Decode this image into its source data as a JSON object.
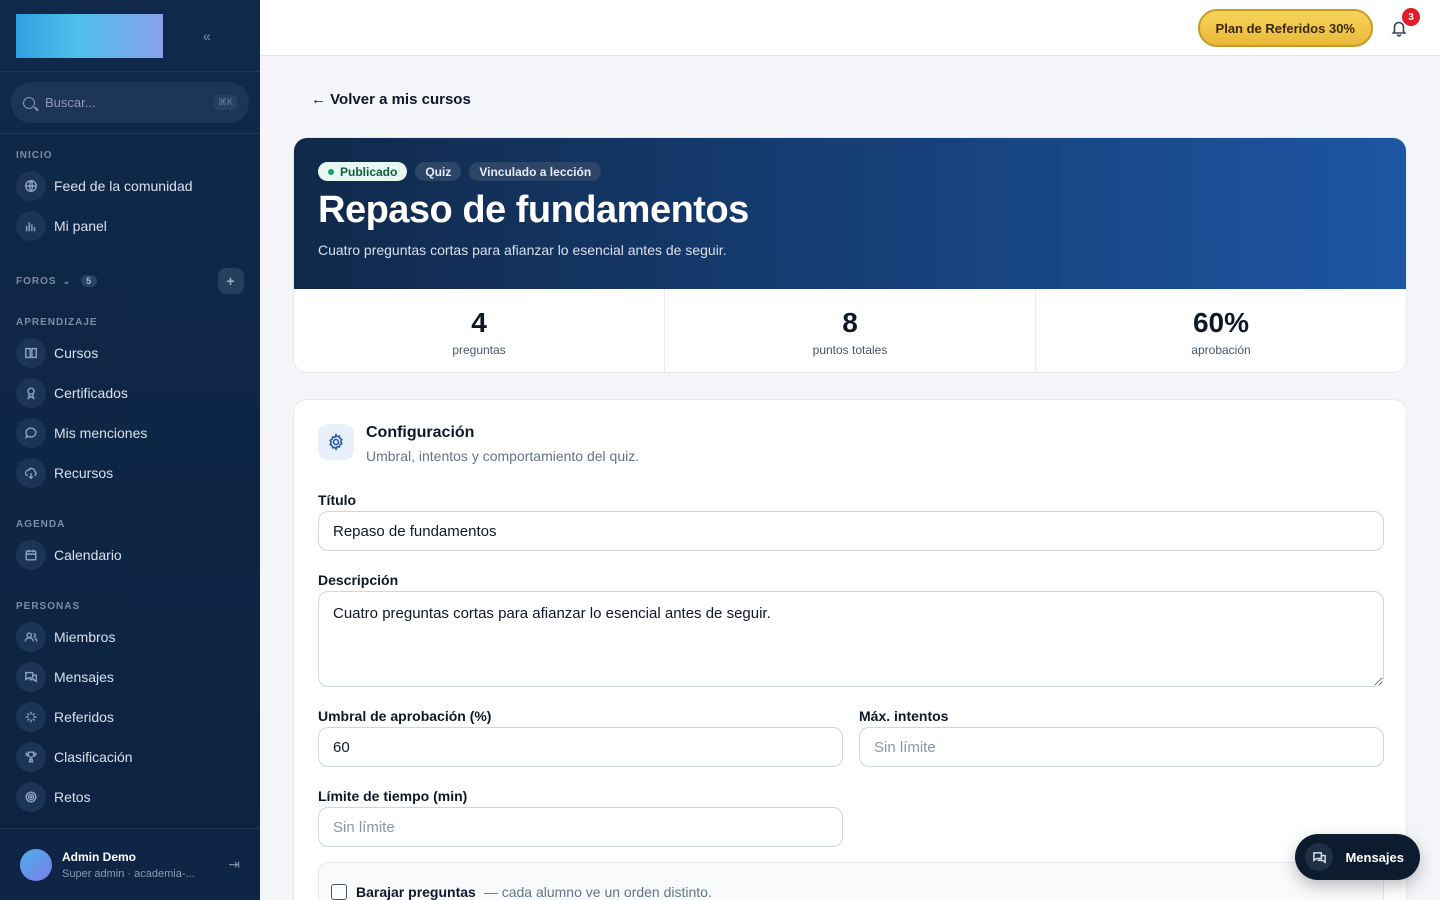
{
  "sidebar": {
    "collapse_glyph": "«",
    "search": {
      "placeholder": "Buscar...",
      "shortcut": "⌘K"
    },
    "sections": {
      "inicio": "INICIO",
      "foros": "FOROS",
      "foros_count": "5",
      "aprendizaje": "APRENDIZAJE",
      "agenda": "AGENDA",
      "personas": "PERSONAS"
    },
    "items": {
      "feed": "Feed de la comunidad",
      "panel": "Mi panel",
      "cursos": "Cursos",
      "certificados": "Certificados",
      "menciones": "Mis menciones",
      "recursos": "Recursos",
      "calendario": "Calendario",
      "miembros": "Miembros",
      "mensajes": "Mensajes",
      "referidos": "Referidos",
      "clasificacion": "Clasificación",
      "retos": "Retos"
    },
    "user": {
      "name": "Admin Demo",
      "role": "Super admin · academia-..."
    }
  },
  "topbar": {
    "referral_label": "Plan de Referidos 30%",
    "notifications_count": "3"
  },
  "main": {
    "back_label": "← Volver a mis cursos",
    "hero": {
      "tags": {
        "published": "Publicado",
        "type": "Quiz",
        "linked": "Vinculado a lección"
      },
      "title": "Repaso de fundamentos",
      "subtitle": "Cuatro preguntas cortas para afianzar lo esencial antes de seguir."
    },
    "stats": {
      "questions_value": "4",
      "questions_label": "preguntas",
      "points_value": "8",
      "points_label": "puntos totales",
      "pass_value": "60%",
      "pass_label": "aprobación"
    },
    "config": {
      "title": "Configuración",
      "subtitle": "Umbral, intentos y comportamiento del quiz.",
      "title_label": "Título",
      "title_value": "Repaso de fundamentos",
      "description_label": "Descripción",
      "description_value": "Cuatro preguntas cortas para afianzar lo esencial antes de seguir.",
      "threshold_label": "Umbral de aprobación (%)",
      "threshold_value": "60",
      "max_attempts_label": "Máx. intentos",
      "max_attempts_placeholder": "Sin límite",
      "time_limit_label": "Límite de tiempo (min)",
      "time_limit_placeholder": "Sin límite",
      "shuffle_label": "Barajar preguntas",
      "shuffle_hint": "— cada alumno ve un orden distinto."
    }
  },
  "floating": {
    "messages_label": "Mensajes"
  },
  "colors": {
    "sidebar_bg": "#10294a",
    "accent_gold": "#f7d45a",
    "hero_end": "#1d56a3",
    "badge_red": "#e11d2a"
  }
}
